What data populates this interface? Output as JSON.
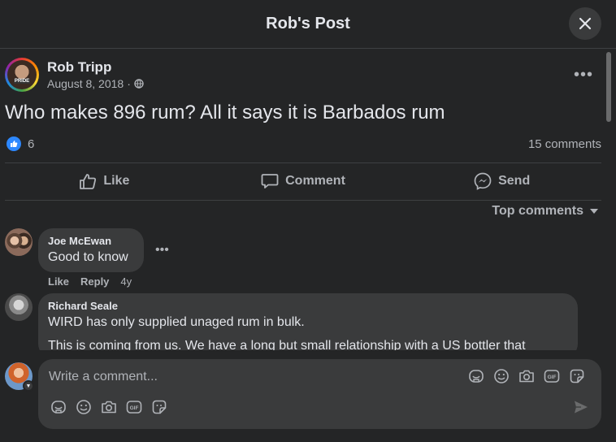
{
  "header": {
    "title": "Rob's Post"
  },
  "post": {
    "author": "Rob Tripp",
    "avatar_badge": "PRIDE",
    "date": "August 8, 2018",
    "text": "Who makes 896 rum? All it says it is Barbados rum",
    "reaction_count": "6",
    "comment_count": "15 comments"
  },
  "actions": {
    "like": "Like",
    "comment": "Comment",
    "send": "Send"
  },
  "sort": {
    "label": "Top comments"
  },
  "comments": [
    {
      "name": "Joe McEwan",
      "text": "Good to know",
      "like": "Like",
      "reply": "Reply",
      "age": "4y"
    },
    {
      "name": "Richard Seale",
      "text": "WIRD has only supplied unaged rum in bulk.",
      "text2": "This is coming from us. We have a long but small relationship with a US bottler that"
    }
  ],
  "composer": {
    "placeholder": "Write a comment..."
  },
  "colors": {
    "background": "#242526",
    "surface": "#3a3b3c",
    "text": "#e4e6eb",
    "muted": "#b0b3b8",
    "like_blue": "#2d88ff"
  },
  "icons": [
    "close-icon",
    "globe-icon",
    "more-icon",
    "thumbs-up-icon",
    "comment-icon",
    "messenger-icon",
    "caret-down-icon",
    "avatar-sticker-icon",
    "emoji-icon",
    "camera-icon",
    "gif-icon",
    "sticker-icon",
    "send-icon"
  ]
}
